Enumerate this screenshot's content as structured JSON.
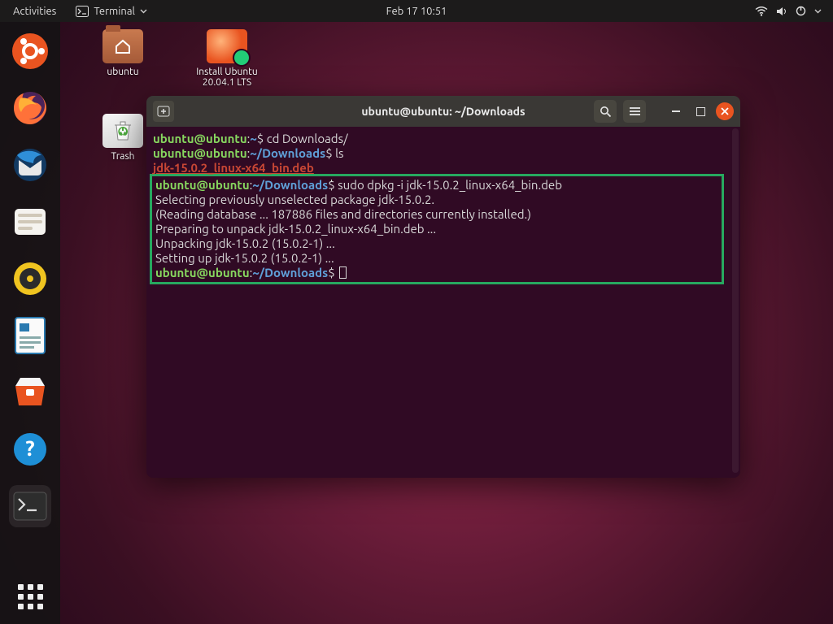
{
  "topbar": {
    "activities": "Activities",
    "app_name": "Terminal",
    "clock": "Feb 17  10:51"
  },
  "desktop": {
    "home_label": "ubuntu",
    "installer_label_l1": "Install Ubuntu",
    "installer_label_l2": "20.04.1 LTS",
    "trash_label": "Trash"
  },
  "window": {
    "title": "ubuntu@ubuntu: ~/Downloads"
  },
  "terminal": {
    "prompts": {
      "user_host": "ubuntu@ubuntu",
      "home": "~",
      "downloads": "~/Downloads"
    },
    "commands": {
      "cd": "cd Downloads/",
      "ls": "ls",
      "dpkg": "sudo dpkg -i jdk-15.0.2_linux-x64_bin.deb"
    },
    "ls_output": "jdk-15.0.2_linux-x64_bin.deb",
    "dpkg_output": [
      "Selecting previously unselected package jdk-15.0.2.",
      "(Reading database ... 187886 files and directories currently installed.)",
      "Preparing to unpack jdk-15.0.2_linux-x64_bin.deb ...",
      "Unpacking jdk-15.0.2 (15.0.2-1) ...",
      "Setting up jdk-15.0.2 (15.0.2-1) ..."
    ]
  }
}
